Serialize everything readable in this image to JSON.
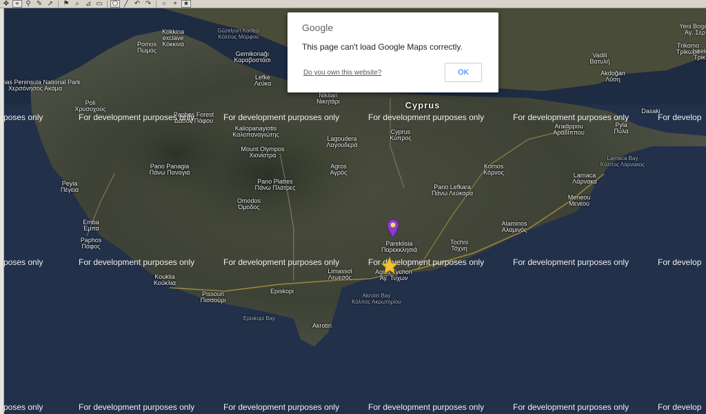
{
  "toolbar": {
    "icons": [
      "pan-icon",
      "pin-icon",
      "marker-icon",
      "tools-icon",
      "move-icon",
      "flag-icon",
      "zoom-icon",
      "ruler-icon",
      "select-icon",
      "polygon-icon",
      "line-icon",
      "undo-icon",
      "redo-icon",
      "circle-icon",
      "crosshair-icon",
      "star-icon"
    ]
  },
  "dialog": {
    "logo": "Google",
    "message": "This page can't load Google Maps correctly.",
    "link": "Do you own this website?",
    "ok_label": "OK"
  },
  "watermark": {
    "text": "For development purposes only",
    "edge_text": "rposes only",
    "right_text": "For develop"
  },
  "map": {
    "country": "Cyprus",
    "places": [
      {
        "en": "Kokkina",
        "gr": "exclave\nΚόκκινα"
      },
      {
        "en": "Güzelyurt Korfezi",
        "gr": "Κόλπος Μόρφου"
      },
      {
        "en": "Pomos",
        "gr": "Πωμός"
      },
      {
        "en": "Gemikonağı",
        "gr": "Καραβοστάσι"
      },
      {
        "en": "Lefke",
        "gr": "Λεύκα"
      },
      {
        "en": "Akamas Peninsula National Park",
        "gr": "Χερσόνησος Ακάμα"
      },
      {
        "en": "Poli",
        "gr": "Χρυσοχούς"
      },
      {
        "en": "Paphos Forest",
        "gr": "Δάσος Πάφου"
      },
      {
        "en": "Kaliopanayiotis",
        "gr": "Καλοπαναγιώτης"
      },
      {
        "en": "Mount Olympos",
        "gr": "Χιονίστρα"
      },
      {
        "en": "Lagoudera",
        "gr": "Λαγουδερά"
      },
      {
        "en": "Cyprus",
        "gr": "Κύπρος"
      },
      {
        "en": "Agros",
        "gr": "Αγρός"
      },
      {
        "en": "Pano Panagia",
        "gr": "Πάνω Παναγιά"
      },
      {
        "en": "Peyia",
        "gr": "Πέγεια"
      },
      {
        "en": "Pano Platres",
        "gr": "Πάνω Πλάτρες"
      },
      {
        "en": "Omodos",
        "gr": "Όμοδος"
      },
      {
        "en": "Emba",
        "gr": "Έμπα"
      },
      {
        "en": "Paphos",
        "gr": "Πάφος"
      },
      {
        "en": "Kouklia",
        "gr": "Κούκλια"
      },
      {
        "en": "Pissouri",
        "gr": "Πισσούρι"
      },
      {
        "en": "Episkopi",
        "gr": ""
      },
      {
        "en": "Limassol",
        "gr": "Λεμεσός"
      },
      {
        "en": "Pareklisia",
        "gr": "Παρεκκλησιά"
      },
      {
        "en": "Agios Tychon",
        "gr": "Άγ. Τύχων"
      },
      {
        "en": "Akrotiri Bay",
        "gr": "Κόλπος Ακρωτηρίου"
      },
      {
        "en": "Akrotiri",
        "gr": ""
      },
      {
        "en": "Episkopi Bay",
        "gr": ""
      },
      {
        "en": "Pano Lefkara",
        "gr": "Πάνω Λεύκαρα"
      },
      {
        "en": "Kornos",
        "gr": "Κόρνος"
      },
      {
        "en": "Alaminos",
        "gr": "Αλαμινός"
      },
      {
        "en": "Tochni",
        "gr": "Τόχνη"
      },
      {
        "en": "Aradippou",
        "gr": "Αραδίππου"
      },
      {
        "en": "Larnaca",
        "gr": "Λάρνακα"
      },
      {
        "en": "Larnaca Bay",
        "gr": "Κόλπος Λάρνακας"
      },
      {
        "en": "Meneou",
        "gr": "Μενεού"
      },
      {
        "en": "Pyla",
        "gr": "Πύλα"
      },
      {
        "en": "Dasaki",
        "gr": ""
      },
      {
        "en": "Vadili",
        "gr": "Βατυλή"
      },
      {
        "en": "Akdoğan",
        "gr": "Λύση"
      },
      {
        "en": "Nikitari",
        "gr": "Νικητάρι"
      },
      {
        "en": "Yeni Bogaz",
        "gr": "Άγ. Σέρ"
      },
      {
        "en": "Trikomo",
        "gr": "Τρίκωμο"
      },
      {
        "en": "Iskele",
        "gr": "Τρίκ."
      }
    ]
  },
  "colors": {
    "sea": "#1f2a3d",
    "land": "#3b3f33",
    "pin": "#8e3bd1",
    "star": "#f2c230"
  }
}
